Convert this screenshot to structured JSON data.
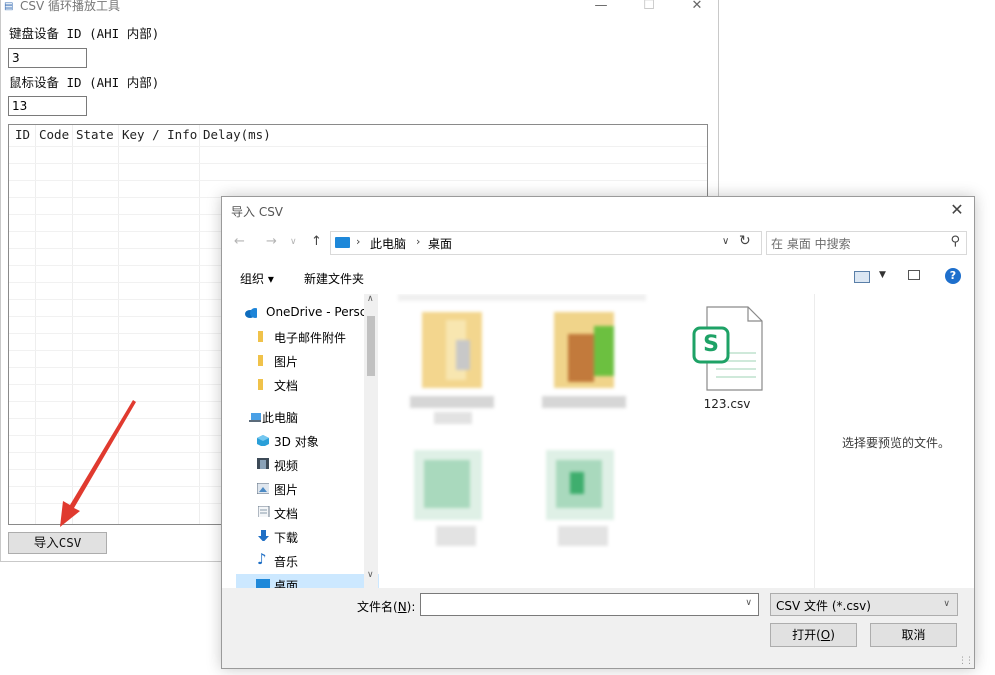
{
  "app": {
    "title": "CSV 循环播放工具",
    "controls": {
      "minimize": "—",
      "maximize": "☐",
      "close": "✕"
    },
    "keyboard_label": "键盘设备 ID (AHI 内部)",
    "keyboard_value": "3",
    "mouse_label": "鼠标设备 ID (AHI 内部)",
    "mouse_value": "13",
    "columns": [
      "ID",
      "Code",
      "State",
      "Key / Info",
      "Delay(ms)"
    ],
    "import_button": "导入CSV",
    "arrow_color": "#e03a2f"
  },
  "dialog": {
    "title": "导入 CSV",
    "close": "✕",
    "nav": {
      "back": "←",
      "forward": "→",
      "dropdown": "∨",
      "up": "↑"
    },
    "breadcrumbs": [
      "此电脑",
      "桌面"
    ],
    "breadcrumb_sep": "›",
    "search_placeholder": "在 桌面 中搜索",
    "toolbar": {
      "organize": "组织 ▾",
      "new_folder": "新建文件夹",
      "help": "?"
    },
    "nav_items": [
      {
        "label": "OneDrive - Persc",
        "icon": "cloud-icon"
      },
      {
        "label": "电子邮件附件",
        "icon": "folder-icon"
      },
      {
        "label": "图片",
        "icon": "folder-icon"
      },
      {
        "label": "文档",
        "icon": "folder-icon"
      },
      {
        "label": "此电脑",
        "icon": "computer-icon"
      },
      {
        "label": "3D 对象",
        "icon": "cube-icon"
      },
      {
        "label": "视频",
        "icon": "video-icon"
      },
      {
        "label": "图片",
        "icon": "pictures-icon"
      },
      {
        "label": "文档",
        "icon": "document-icon"
      },
      {
        "label": "下载",
        "icon": "download-icon"
      },
      {
        "label": "音乐",
        "icon": "music-icon"
      },
      {
        "label": "桌面",
        "icon": "desktop-icon"
      }
    ],
    "csv_file": {
      "name": "123.csv",
      "badge": "S",
      "accent": "#1ea266"
    },
    "preview_text": "选择要预览的文件。",
    "filename_label_prefix": "文件名(",
    "filename_label_key": "N",
    "filename_label_suffix": "):",
    "filename_value": "",
    "filetype": "CSV 文件 (*.csv)",
    "open_prefix": "打开(",
    "open_key": "O",
    "open_suffix": ")",
    "cancel": "取消"
  }
}
